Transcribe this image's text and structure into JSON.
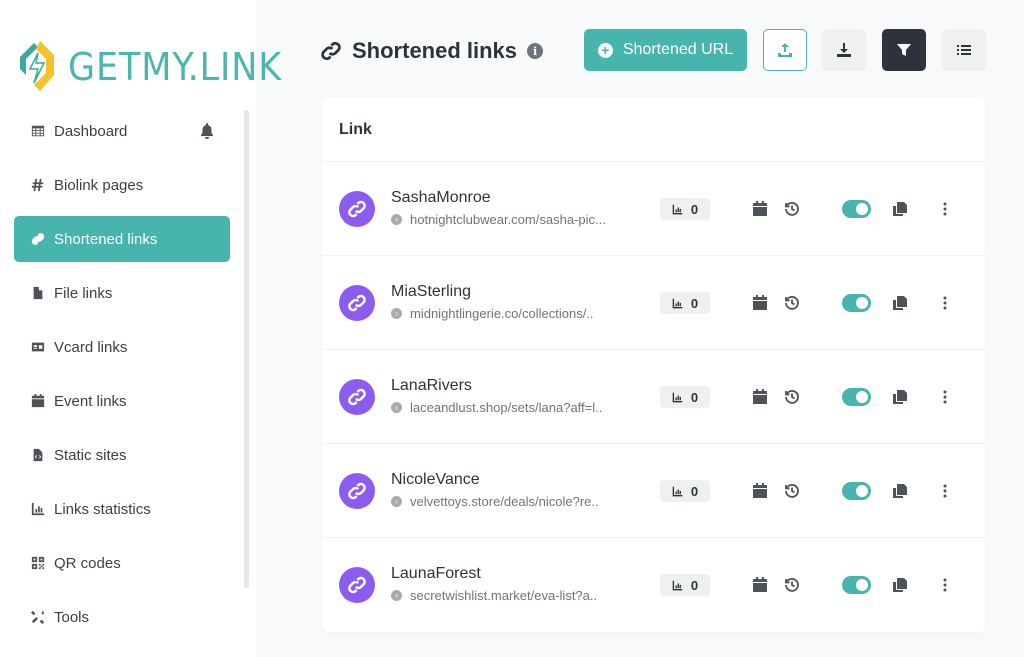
{
  "brand": {
    "name": "GETMY.LINK",
    "accent": "#47b5ad",
    "avatar_color": "#8c5cf0"
  },
  "sidebar": {
    "items": [
      {
        "label": "Dashboard",
        "icon": "table-icon",
        "active": false
      },
      {
        "label": "Biolink pages",
        "icon": "hash-icon",
        "active": false
      },
      {
        "label": "Shortened links",
        "icon": "link-icon",
        "active": true
      },
      {
        "label": "File links",
        "icon": "file-icon",
        "active": false
      },
      {
        "label": "Vcard links",
        "icon": "id-card-icon",
        "active": false
      },
      {
        "label": "Event links",
        "icon": "calendar-icon",
        "active": false
      },
      {
        "label": "Static sites",
        "icon": "file-code-icon",
        "active": false
      },
      {
        "label": "Links statistics",
        "icon": "chart-icon",
        "active": false
      },
      {
        "label": "QR codes",
        "icon": "qrcode-icon",
        "active": false
      },
      {
        "label": "Tools",
        "icon": "tools-icon",
        "active": false
      }
    ]
  },
  "header": {
    "title": "Shortened links",
    "info_glyph": "i",
    "create_button": "Shortened URL"
  },
  "table": {
    "column_header": "Link",
    "rows": [
      {
        "name": "SashaMonroe",
        "url": "hotnightclubwear.com/sasha-pic...",
        "clicks": "0",
        "enabled": true
      },
      {
        "name": "MiaSterling",
        "url": "midnightlingerie.co/collections/..",
        "clicks": "0",
        "enabled": true
      },
      {
        "name": "LanaRivers",
        "url": "laceandlust.shop/sets/lana?aff=l..",
        "clicks": "0",
        "enabled": true
      },
      {
        "name": "NicoleVance",
        "url": "velvettoys.store/deals/nicole?re..",
        "clicks": "0",
        "enabled": true
      },
      {
        "name": "LaunaForest",
        "url": "secretwishlist.market/eva-list?a..",
        "clicks": "0",
        "enabled": true
      }
    ]
  }
}
